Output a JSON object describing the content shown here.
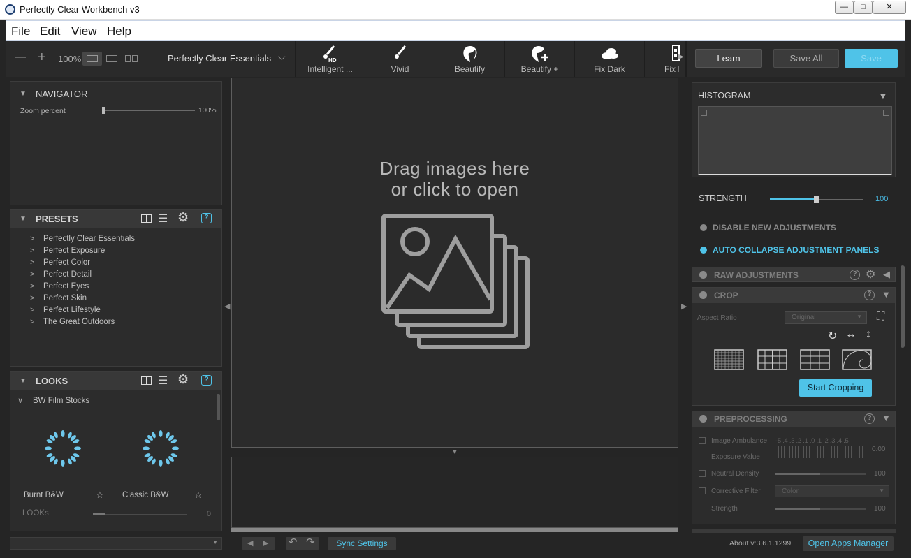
{
  "window": {
    "title": "Perfectly Clear Workbench v3",
    "controls": {
      "minimize": "—",
      "maximize": "□",
      "close": "✕"
    }
  },
  "menu": [
    "File",
    "Edit",
    "View",
    "Help"
  ],
  "toolbar": {
    "zoom_out": "—",
    "zoom_in": "+",
    "zoom_level": "100%",
    "preset_select": "Perfectly Clear Essentials",
    "tools": [
      {
        "label": "Intelligent ...",
        "icon": "brush-hd-icon"
      },
      {
        "label": "Vivid",
        "icon": "brush-icon"
      },
      {
        "label": "Beautify",
        "icon": "face-icon"
      },
      {
        "label": "Beautify +",
        "icon": "face-plus-icon"
      },
      {
        "label": "Fix Dark",
        "icon": "cloud-icon"
      },
      {
        "label": "Fix I",
        "icon": "film-icon"
      }
    ],
    "learn": "Learn",
    "save_all": "Save All",
    "save": "Save"
  },
  "navigator": {
    "title": "NAVIGATOR",
    "zoom_label": "Zoom percent",
    "zoom_value": "100%",
    "zoom_fraction": 0.0
  },
  "presets": {
    "title": "PRESETS",
    "items": [
      "Perfectly Clear Essentials",
      "Perfect Exposure",
      "Perfect Color",
      "Perfect Detail",
      "Perfect Eyes",
      "Perfect Skin",
      "Perfect Lifestyle",
      "The Great Outdoors"
    ]
  },
  "looks": {
    "title": "LOOKS",
    "group": "BW Film Stocks",
    "items": [
      "Burnt B&W",
      "Classic B&W"
    ],
    "slider_label": "LOOKs",
    "slider_value": "0",
    "star": "☆"
  },
  "canvas": {
    "drop_line1": "Drag images here",
    "drop_line2": "or click to open"
  },
  "histogram": {
    "title": "HISTOGRAM"
  },
  "strength": {
    "label": "STRENGTH",
    "value": "100",
    "fraction": 0.5
  },
  "options": [
    {
      "label": "DISABLE NEW ADJUSTMENTS",
      "active": false
    },
    {
      "label": "AUTO COLLAPSE ADJUSTMENT PANELS",
      "active": true
    }
  ],
  "raw": {
    "title": "RAW ADJUSTMENTS"
  },
  "crop": {
    "title": "CROP",
    "aspect_label": "Aspect Ratio",
    "aspect_value": "Original",
    "start": "Start Cropping"
  },
  "preprocessing": {
    "title": "PREPROCESSING",
    "ambulance_label": "Image Ambulance",
    "ambulance_scale": "-5 .4 .3 .2 .1 .0 .1 .2 .3 .4 .5",
    "exposure_label": "Exposure Value",
    "exposure_value": "0.00",
    "neutral_label": "Neutral Density",
    "neutral_value": "100",
    "filter_label": "Corrective Filter",
    "filter_value": "Color",
    "strength_label": "Strength",
    "strength_value": "100"
  },
  "status": {
    "sync": "Sync Settings",
    "about": "About v:3.6.1.1299",
    "open_apps": "Open Apps Manager"
  },
  "colors": {
    "accent": "#4fc3e8",
    "accent_text": "#49b9e2"
  }
}
